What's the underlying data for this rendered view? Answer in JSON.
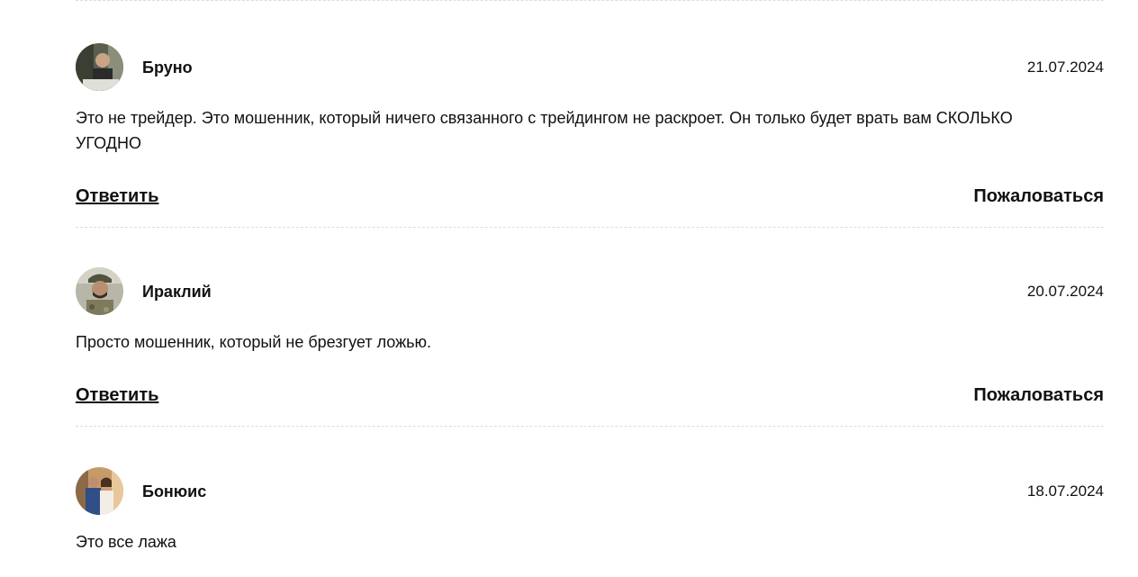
{
  "comments": [
    {
      "author": "Бруно",
      "date": "21.07.2024",
      "text": "Это не трейдер. Это мошенник, который ничего связанного с трейдингом не раскроет. Он только будет врать вам СКОЛЬКО УГОДНО",
      "reply_label": "Ответить",
      "complain_label": "Пожаловаться"
    },
    {
      "author": "Ираклий",
      "date": "20.07.2024",
      "text": "Просто мошенник, который не брезгует ложью.",
      "reply_label": "Ответить",
      "complain_label": "Пожаловаться"
    },
    {
      "author": "Бонюис",
      "date": "18.07.2024",
      "text": "Это все лажа"
    }
  ]
}
